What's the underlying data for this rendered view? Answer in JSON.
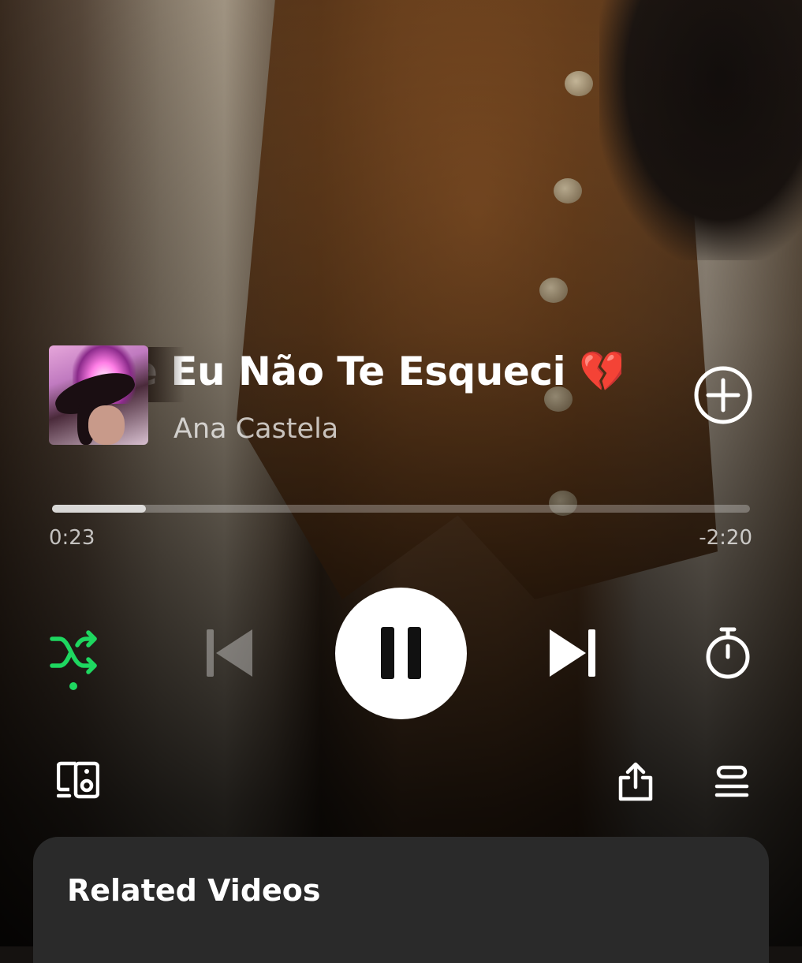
{
  "track": {
    "title": "e Eu Não Te Esqueci 💔",
    "artist": "Ana Castela"
  },
  "progress": {
    "elapsed": "0:23",
    "remaining": "-2:20",
    "fraction": 0.135
  },
  "controls": {
    "shuffle_active": true,
    "accent_color": "#1ed760",
    "state": "playing"
  },
  "related": {
    "title": "Related Videos"
  },
  "icons": {
    "add": "plus-circle-icon",
    "shuffle": "shuffle-icon",
    "previous": "skip-previous-icon",
    "pause": "pause-icon",
    "next": "skip-next-icon",
    "timer": "sleep-timer-icon",
    "devices": "connect-devices-icon",
    "share": "share-icon",
    "queue": "queue-icon"
  }
}
